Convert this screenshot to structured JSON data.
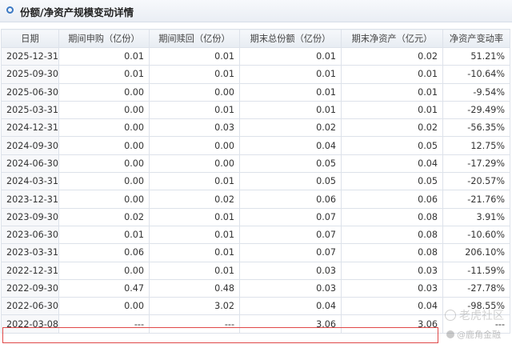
{
  "header": {
    "title": "份额/净资产规模变动详情"
  },
  "table": {
    "columns": [
      "日期",
      "期间申购（亿份）",
      "期间赎回（亿份）",
      "期末总份额（亿份）",
      "期末净资产（亿元）",
      "净资产变动率"
    ],
    "rows": [
      [
        "2025-12-31",
        "0.01",
        "0.01",
        "0.01",
        "0.02",
        "51.21%"
      ],
      [
        "2025-09-30",
        "0.01",
        "0.01",
        "0.01",
        "0.01",
        "-10.64%"
      ],
      [
        "2025-06-30",
        "0.00",
        "0.00",
        "0.01",
        "0.01",
        "-9.54%"
      ],
      [
        "2025-03-31",
        "0.00",
        "0.01",
        "0.01",
        "0.01",
        "-29.49%"
      ],
      [
        "2024-12-31",
        "0.00",
        "0.03",
        "0.02",
        "0.02",
        "-56.35%"
      ],
      [
        "2024-09-30",
        "0.00",
        "0.00",
        "0.04",
        "0.05",
        "12.75%"
      ],
      [
        "2024-06-30",
        "0.00",
        "0.00",
        "0.05",
        "0.04",
        "-17.29%"
      ],
      [
        "2024-03-31",
        "0.00",
        "0.01",
        "0.05",
        "0.05",
        "-20.57%"
      ],
      [
        "2023-12-31",
        "0.00",
        "0.02",
        "0.06",
        "0.06",
        "-21.76%"
      ],
      [
        "2023-09-30",
        "0.02",
        "0.01",
        "0.07",
        "0.08",
        "3.91%"
      ],
      [
        "2023-06-30",
        "0.01",
        "0.01",
        "0.07",
        "0.08",
        "-10.60%"
      ],
      [
        "2023-03-31",
        "0.06",
        "0.01",
        "0.07",
        "0.08",
        "206.10%"
      ],
      [
        "2022-12-31",
        "0.00",
        "0.01",
        "0.03",
        "0.03",
        "-11.59%"
      ],
      [
        "2022-09-30",
        "0.47",
        "0.48",
        "0.03",
        "0.03",
        "-27.78%"
      ],
      [
        "2022-06-30",
        "0.00",
        "3.02",
        "0.04",
        "0.04",
        "-98.55%"
      ],
      [
        "2022-03-08",
        "---",
        "---",
        "3.06",
        "3.06",
        "---"
      ]
    ]
  },
  "watermark": {
    "primary": "老虎社区",
    "secondary": "@鹿角金融"
  },
  "colors": {
    "highlight": "#e04848",
    "accent": "#3a78c3"
  }
}
